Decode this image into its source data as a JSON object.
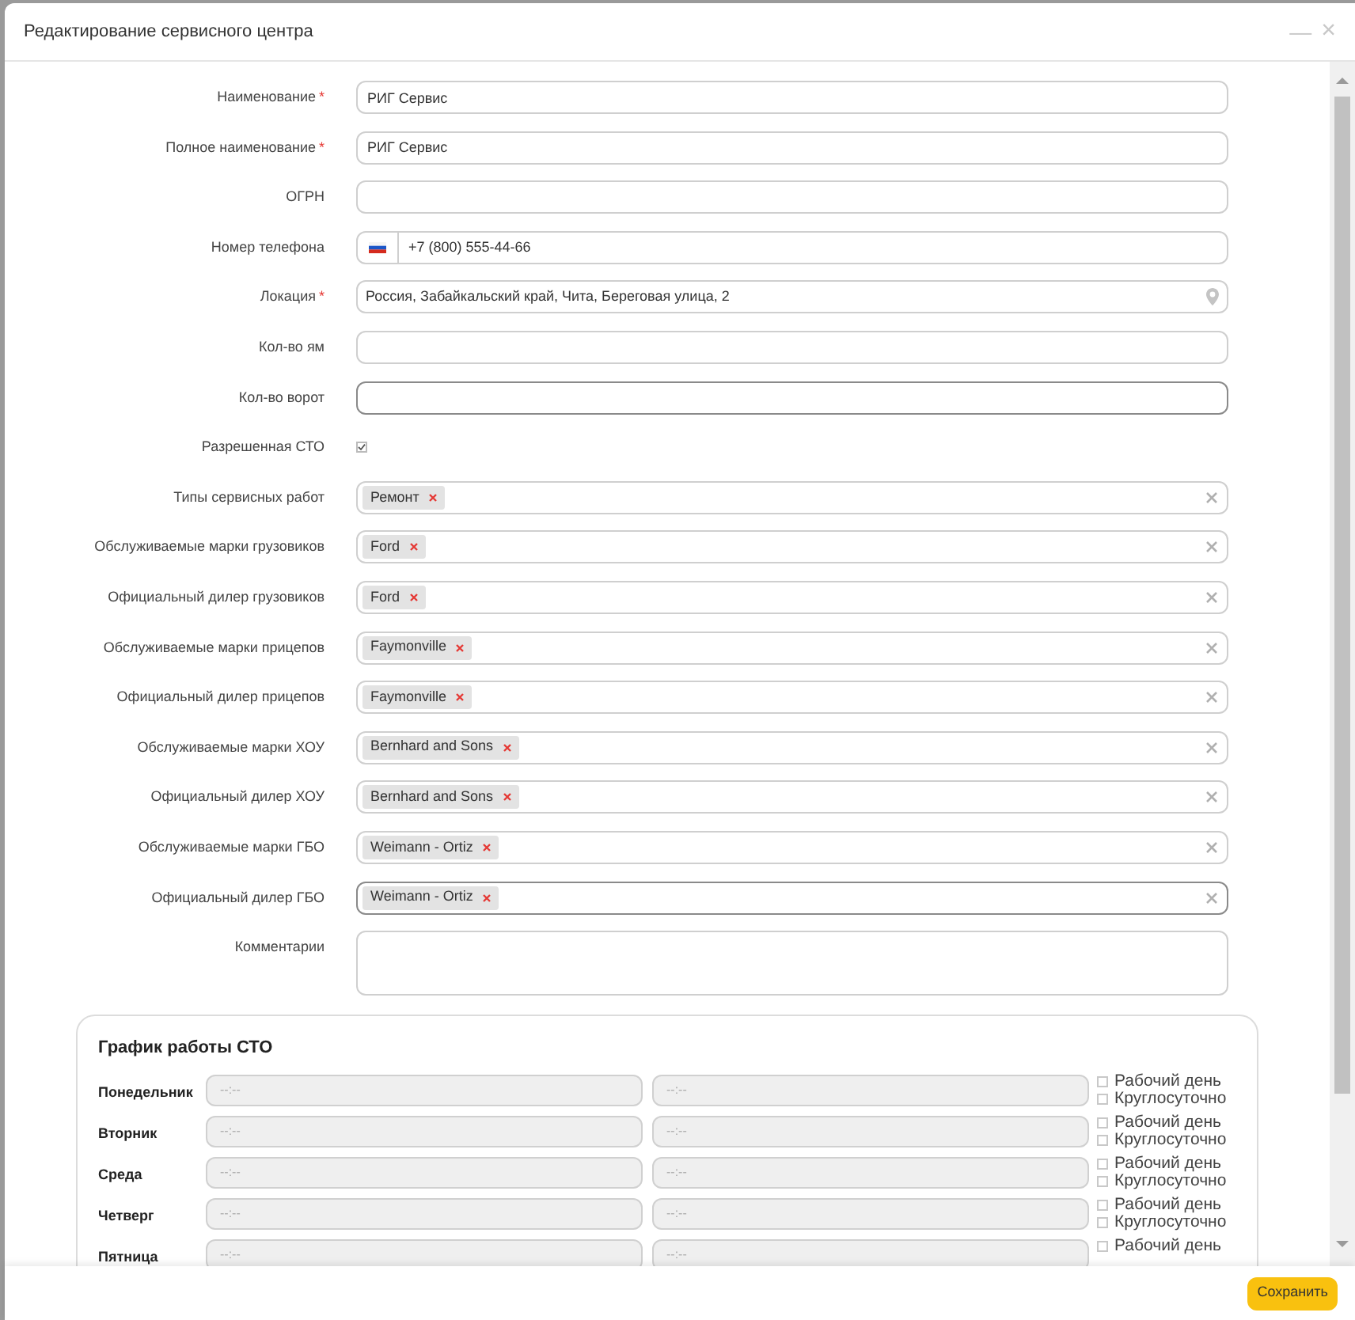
{
  "window": {
    "title": "Редактирование сервисного центра",
    "controls": [
      "—",
      "×"
    ]
  },
  "fields": [
    {
      "kind": "text",
      "label": "Наименование",
      "required_mark": "*",
      "value": "РИГ Сервис",
      "focused": false
    },
    {
      "kind": "text",
      "label": "Полное наименование",
      "required_mark": "*",
      "value": "РИГ Сервис",
      "focused": false
    },
    {
      "kind": "text",
      "label": "ОГРН",
      "focused": false
    },
    {
      "kind": "phone",
      "label": "Номер телефона",
      "value": "+7 (800) 555-44-66",
      "focused": false
    },
    {
      "kind": "location",
      "label": "Локация",
      "required_mark": "*",
      "value": "Россия, Забайкальский край, Чита, Береговая улица, 2",
      "focused": false
    },
    {
      "kind": "text",
      "label": "Кол-во ям",
      "focused": false
    },
    {
      "kind": "text",
      "label": "Кол-во ворот",
      "focused": true
    },
    {
      "kind": "checkbox",
      "label": "Разрешенная СТО",
      "checked": true
    },
    {
      "kind": "tags",
      "label": "Типы сервисных работ",
      "tags": [
        "Ремонт"
      ],
      "focused": false
    },
    {
      "kind": "tags",
      "label": "Обслуживаемые марки грузовиков",
      "tags": [
        "Ford"
      ],
      "focused": false
    },
    {
      "kind": "tags",
      "label": "Официальный дилер грузовиков",
      "tags": [
        "Ford"
      ],
      "focused": false
    },
    {
      "kind": "tags",
      "label": "Обслуживаемые марки прицепов",
      "tags": [
        "Faymonville"
      ],
      "focused": false
    },
    {
      "kind": "tags",
      "label": "Официальный дилер прицепов",
      "tags": [
        "Faymonville"
      ],
      "focused": false
    },
    {
      "kind": "tags",
      "label": "Обслуживаемые марки ХОУ",
      "tags": [
        "Bernhard and Sons"
      ],
      "focused": false
    },
    {
      "kind": "tags",
      "label": "Официальный дилер ХОУ",
      "tags": [
        "Bernhard and Sons"
      ],
      "focused": false
    },
    {
      "kind": "tags",
      "label": "Обслуживаемые марки ГБО",
      "tags": [
        "Weimann - Ortiz"
      ],
      "focused": false
    },
    {
      "kind": "tags",
      "label": "Официальный дилер ГБО",
      "tags": [
        "Weimann - Ortiz"
      ],
      "focused": true
    },
    {
      "kind": "textarea",
      "label": "Комментарии",
      "focused": false
    }
  ],
  "schedule": {
    "title": "График работы СТО",
    "days": [
      {
        "day": "Понедельник",
        "from_placeholder": "--:--",
        "to_placeholder": "--:--",
        "options": [
          {
            "label": "Рабочий день",
            "checked": false
          },
          {
            "label": "Круглосуточно",
            "checked": false
          }
        ]
      },
      {
        "day": "Вторник",
        "from_placeholder": "--:--",
        "to_placeholder": "--:--",
        "options": [
          {
            "label": "Рабочий день",
            "checked": false
          },
          {
            "label": "Круглосуточно",
            "checked": false
          }
        ]
      },
      {
        "day": "Среда",
        "from_placeholder": "--:--",
        "to_placeholder": "--:--",
        "options": [
          {
            "label": "Рабочий день",
            "checked": false
          },
          {
            "label": "Круглосуточно",
            "checked": false
          }
        ]
      },
      {
        "day": "Четверг",
        "from_placeholder": "--:--",
        "to_placeholder": "--:--",
        "options": [
          {
            "label": "Рабочий день",
            "checked": false
          },
          {
            "label": "Круглосуточно",
            "checked": false
          }
        ]
      },
      {
        "day": "Пятница",
        "from_placeholder": "--:--",
        "to_placeholder": "--:--",
        "options": [
          {
            "label": "Рабочий день",
            "checked": false
          }
        ]
      }
    ]
  },
  "footer": {
    "save_button": "Сохранить"
  }
}
